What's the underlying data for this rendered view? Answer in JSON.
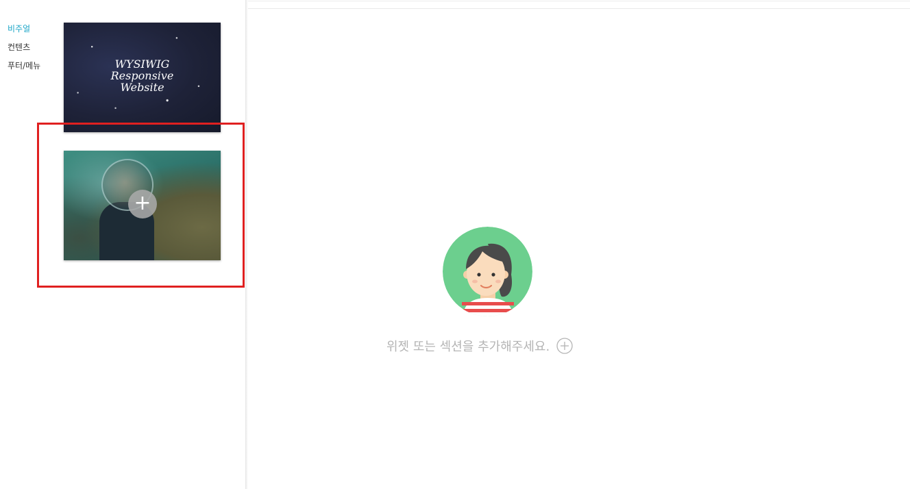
{
  "sidebar": {
    "categories": [
      {
        "label": "비주얼",
        "active": true
      },
      {
        "label": "컨텐츠",
        "active": false
      },
      {
        "label": "푸터/메뉴",
        "active": false
      }
    ],
    "accent_color": "#1aa5c7"
  },
  "templates": [
    {
      "title_lines": [
        "WYSIWIG",
        "Responsive",
        "Website"
      ]
    },
    {
      "title_lines": []
    }
  ],
  "highlight_color": "#e02020",
  "main": {
    "empty_message": "위젯 또는 섹션을 추가해주세요.",
    "add_icon": "plus-circle-icon",
    "avatar_icon": "person-avatar-icon"
  }
}
